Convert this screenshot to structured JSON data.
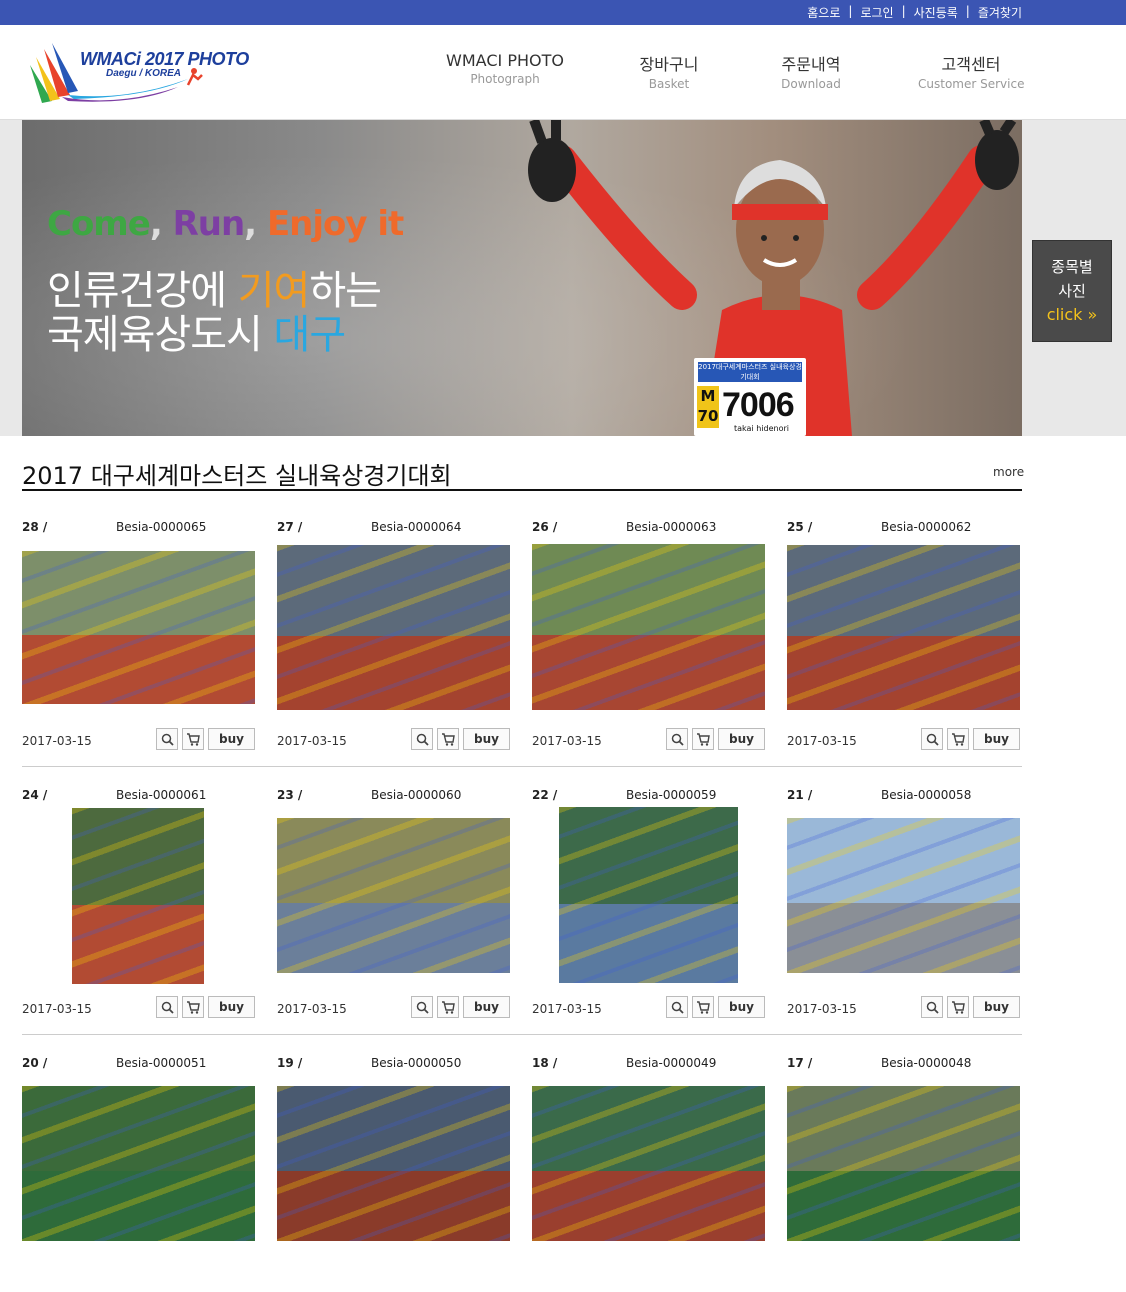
{
  "topbar": {
    "links": [
      "홈으로",
      "로그인",
      "사진등록",
      "즐겨찾기"
    ]
  },
  "logo": {
    "title": "WMACi 2017 PHOTO",
    "subtitle": "Daegu / KOREA"
  },
  "nav": [
    {
      "main": "WMACI PHOTO",
      "sub": "Photograph"
    },
    {
      "main": "장바구니",
      "sub": "Basket"
    },
    {
      "main": "주문내역",
      "sub": "Download"
    },
    {
      "main": "고객센터",
      "sub": "Customer Service"
    }
  ],
  "banner": {
    "slogan": {
      "w1": "Come",
      "w2": "Run",
      "w3": "Enjoy it"
    },
    "line1": {
      "a": "인류건강에 ",
      "b": "기여",
      "c": "하는"
    },
    "line2": {
      "a": "국제육상도시 ",
      "b": "대구"
    },
    "bib": {
      "event": "2017대구세계마스터즈 실내육상경기대회",
      "category": "M 70",
      "number": "7006",
      "name": "takai hidenori"
    }
  },
  "side_button": {
    "line1": "종목별",
    "line2": "사진",
    "click": "click »"
  },
  "section": {
    "title": "2017 대구세계마스터즈 실내육상경기대회",
    "more": "more"
  },
  "cards": [
    {
      "num": "28  /",
      "code": "Besia-0000065",
      "date": "2017-03-15",
      "buy": "buy"
    },
    {
      "num": "27  /",
      "code": "Besia-0000064",
      "date": "2017-03-15",
      "buy": "buy"
    },
    {
      "num": "26  /",
      "code": "Besia-0000063",
      "date": "2017-03-15",
      "buy": "buy"
    },
    {
      "num": "25  /",
      "code": "Besia-0000062",
      "date": "2017-03-15",
      "buy": "buy"
    },
    {
      "num": "24  /",
      "code": "Besia-0000061",
      "date": "2017-03-15",
      "buy": "buy"
    },
    {
      "num": "23  /",
      "code": "Besia-0000060",
      "date": "2017-03-15",
      "buy": "buy"
    },
    {
      "num": "22  /",
      "code": "Besia-0000059",
      "date": "2017-03-15",
      "buy": "buy"
    },
    {
      "num": "21  /",
      "code": "Besia-0000058",
      "date": "2017-03-15",
      "buy": "buy"
    },
    {
      "num": "20  /",
      "code": "Besia-0000051"
    },
    {
      "num": "19  /",
      "code": "Besia-0000050"
    },
    {
      "num": "18  /",
      "code": "Besia-0000049"
    },
    {
      "num": "17  /",
      "code": "Besia-0000048"
    }
  ],
  "colors": {
    "topbar": "#3b55b3",
    "accent_orange": "#f29b1f",
    "accent_blue": "#2aa7e0"
  },
  "icons": [
    "magnifier-icon",
    "cart-icon"
  ]
}
